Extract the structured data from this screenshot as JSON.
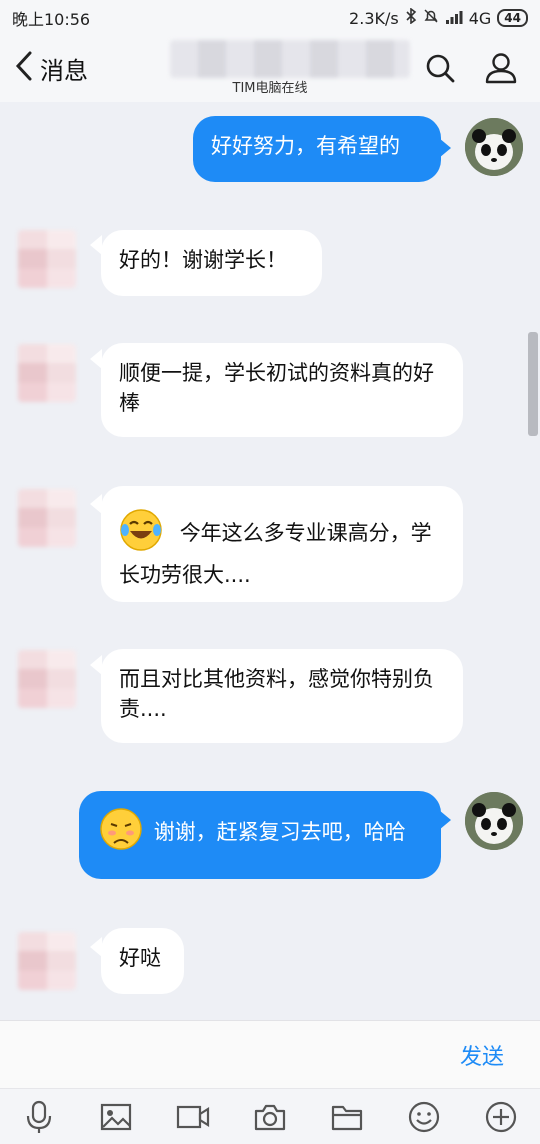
{
  "status": {
    "time": "晚上10:56",
    "speed": "2.3K/s",
    "network": "4G",
    "battery": "44"
  },
  "header": {
    "back_label": "消息",
    "subtitle": "TIM电脑在线"
  },
  "messages": [
    {
      "dir": "out",
      "text": "好好努力，有希望的"
    },
    {
      "dir": "in",
      "text": "好的！谢谢学长！"
    },
    {
      "dir": "in",
      "text": "顺便一提，学长初试的资料真的好棒"
    },
    {
      "dir": "in",
      "emoji": "laughing-crying-face",
      "text": "今年这么多专业课高分，学长功劳很大...."
    },
    {
      "dir": "in",
      "text": "而且对比其他资料，感觉你特别负责...."
    },
    {
      "dir": "out",
      "emoji": "shy-face",
      "text": "谢谢，赶紧复习去吧，哈哈"
    },
    {
      "dir": "in",
      "text": "好哒"
    }
  ],
  "input": {
    "send_label": "发送"
  },
  "toolbar": [
    "microphone-icon",
    "image-icon",
    "video-icon",
    "camera-icon",
    "folder-icon",
    "emoji-icon",
    "plus-icon"
  ],
  "colors": {
    "accent": "#1e8bf6",
    "background": "#eef0f5"
  }
}
